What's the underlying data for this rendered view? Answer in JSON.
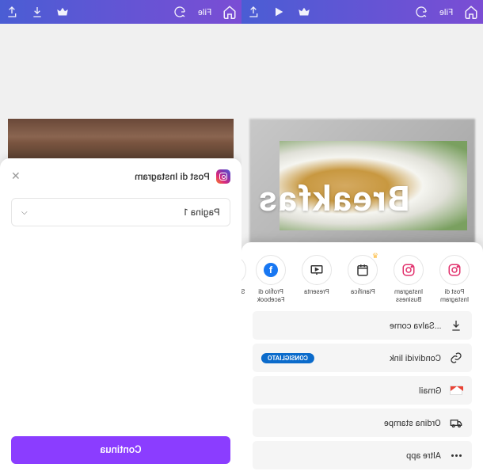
{
  "toolbar": {
    "file_label": "File"
  },
  "left_sheet": {
    "title": "Post di Instagram",
    "page_label": "Pagina 1",
    "continue_label": "Continua"
  },
  "right_canvas": {
    "overlay_text": "Breakfas"
  },
  "share_targets": [
    {
      "label": "Post di Instagram",
      "icon": "instagram",
      "premium": false
    },
    {
      "label": "Instagram Business",
      "icon": "instagram",
      "premium": false
    },
    {
      "label": "Pianifica",
      "icon": "calendar",
      "premium": true
    },
    {
      "label": "Presenta",
      "icon": "present",
      "premium": false
    },
    {
      "label": "Profilo di Facebook",
      "icon": "facebook",
      "premium": false
    },
    {
      "label": "S Fa",
      "icon": "cut",
      "premium": false
    }
  ],
  "actions": {
    "save_as": "Salva come...",
    "share_link": "Condividi link",
    "recommended_badge": "CONSIGLIATO",
    "gmail": "Gmail",
    "order_prints": "Ordina stampe",
    "more_apps": "Altre app"
  }
}
